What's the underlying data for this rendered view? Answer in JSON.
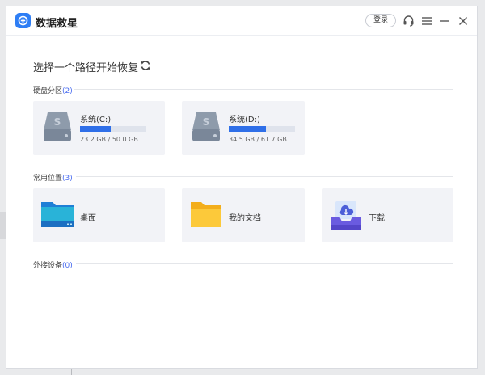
{
  "app": {
    "title": "数据救星",
    "login_label": "登录"
  },
  "page": {
    "title": "选择一个路径开始恢复"
  },
  "sections": {
    "drives": {
      "label": "硬盘分区",
      "count": "(2)"
    },
    "common": {
      "label": "常用位置",
      "count": "(3)"
    },
    "external": {
      "label": "外接设备",
      "count": "(0)"
    }
  },
  "drives": [
    {
      "name": "系统(C:)",
      "size": "23.2 GB / 50.0 GB",
      "used_fraction": 0.464
    },
    {
      "name": "系统(D:)",
      "size": "34.5 GB / 61.7 GB",
      "used_fraction": 0.559
    }
  ],
  "locations": [
    {
      "label": "桌面",
      "icon": "desktop-icon"
    },
    {
      "label": "我的文档",
      "icon": "folder-icon"
    },
    {
      "label": "下载",
      "icon": "download-icon"
    }
  ],
  "colors": {
    "accent": "#2f6fe8",
    "card_bg": "#f2f3f7",
    "count": "#4a6df0"
  }
}
